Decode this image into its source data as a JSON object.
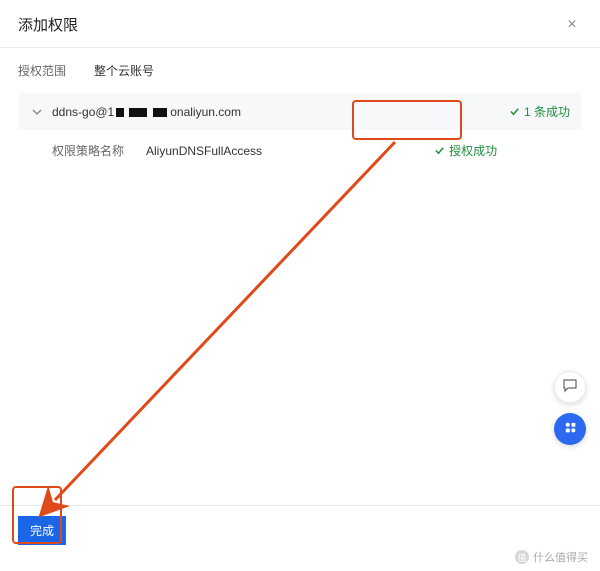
{
  "dialog": {
    "title": "添加权限",
    "close_label": "×"
  },
  "scope": {
    "label": "授权范围",
    "value": "整个云账号"
  },
  "result": {
    "principal_prefix": "ddns-go@1",
    "principal_suffix": "onaliyun.com",
    "summary": "1 条成功"
  },
  "policy": {
    "label": "权限策略名称",
    "name": "AliyunDNSFullAccess",
    "status": "授权成功"
  },
  "footer": {
    "done": "完成"
  },
  "watermark": {
    "text": "什么值得买",
    "badge": "值"
  }
}
